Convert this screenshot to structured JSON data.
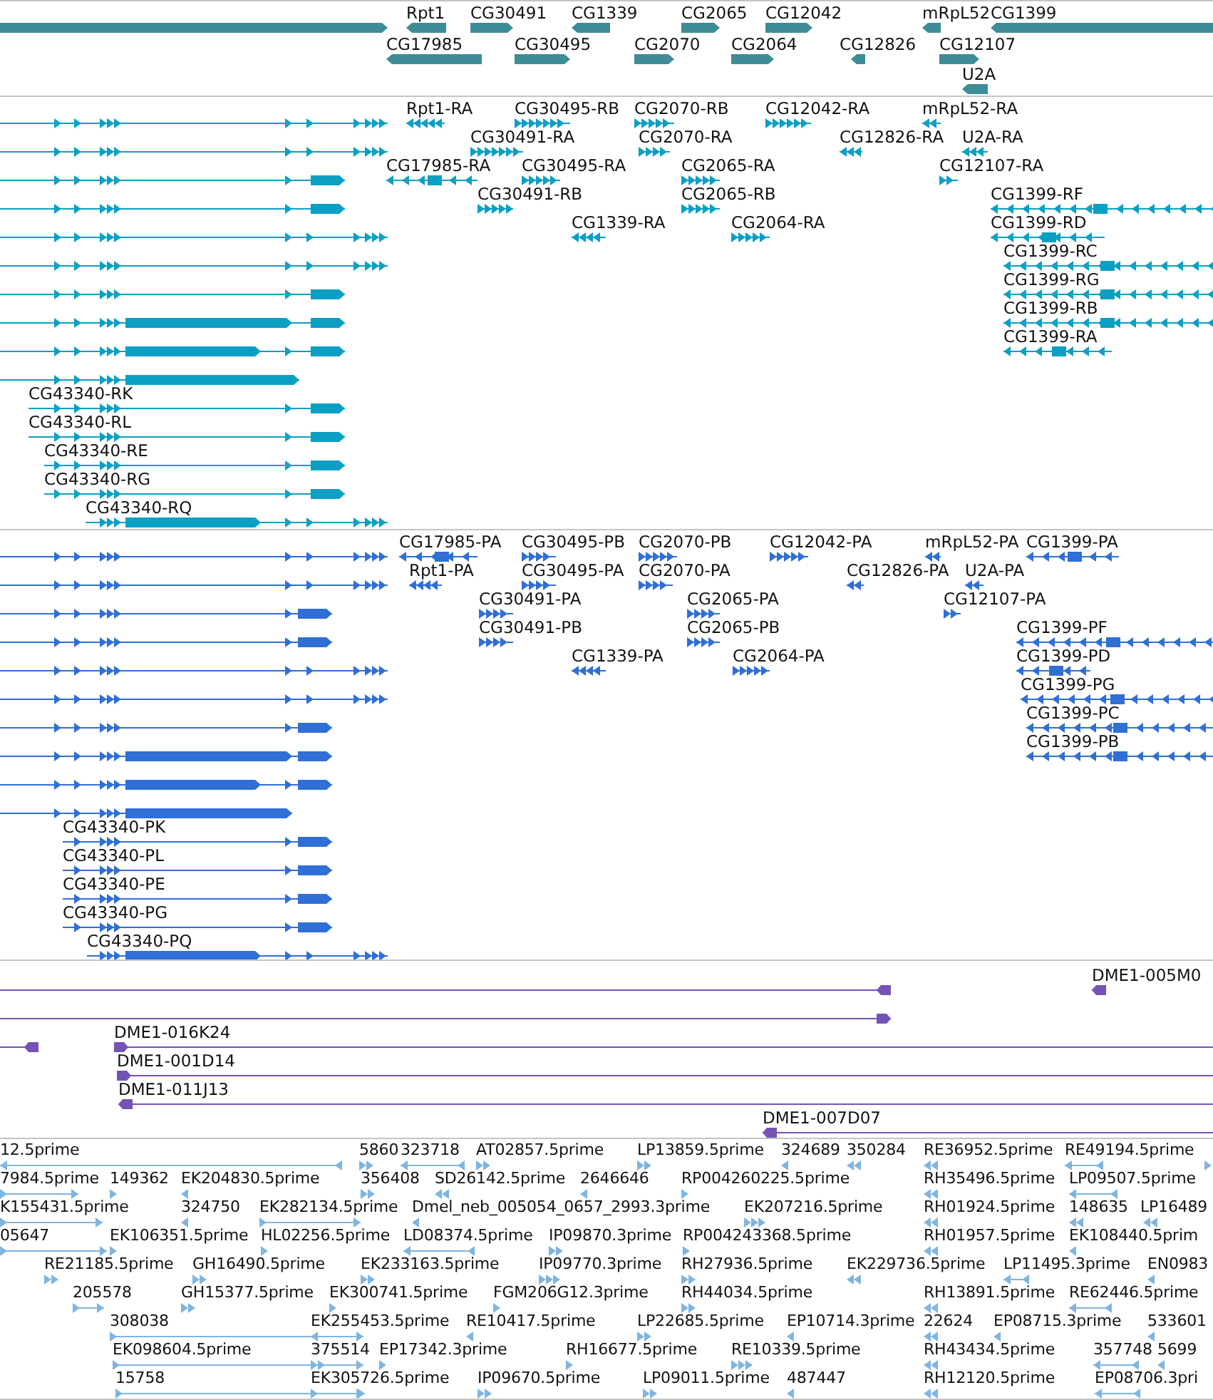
{
  "tracks": [
    {
      "kind": "gene",
      "features": [
        {
          "reverse": false
        },
        {
          "label": "Rpt1",
          "reverse": true
        },
        {
          "label": "CG30491",
          "reverse": false
        },
        {
          "label": "CG1339",
          "reverse": true
        },
        {
          "label": "CG2065",
          "reverse": false
        },
        {
          "label": "CG12042",
          "reverse": false
        },
        {
          "label": "mRpL52",
          "reverse": true
        },
        {
          "label": "CG1399",
          "reverse": true
        },
        {
          "label": "CG17985",
          "reverse": true
        },
        {
          "label": "CG30495",
          "reverse": false
        },
        {
          "label": "CG2070",
          "reverse": false
        },
        {
          "label": "CG2064",
          "reverse": false
        },
        {
          "label": "CG12826",
          "reverse": true
        },
        {
          "label": "CG12107",
          "reverse": false
        },
        {
          "label": "U2A",
          "reverse": true
        }
      ]
    },
    {
      "kind": "transcript",
      "features": [
        {
          "reverse": false
        },
        {
          "reverse": false
        },
        {
          "reverse": false
        },
        {
          "reverse": false
        },
        {
          "reverse": false
        },
        {
          "reverse": false
        },
        {
          "reverse": false
        },
        {
          "reverse": false
        },
        {
          "reverse": false
        },
        {
          "reverse": false
        },
        {
          "label": "CG43340-RK",
          "reverse": false
        },
        {
          "label": "CG43340-RL",
          "reverse": false
        },
        {
          "label": "CG43340-RE",
          "reverse": false
        },
        {
          "label": "CG43340-RG",
          "reverse": false
        },
        {
          "label": "CG43340-RQ",
          "reverse": false
        },
        {
          "label": "Rpt1-RA",
          "reverse": true
        },
        {
          "label": "CG30495-RB",
          "reverse": false
        },
        {
          "label": "CG2070-RB",
          "reverse": false
        },
        {
          "label": "CG12042-RA",
          "reverse": false
        },
        {
          "label": "mRpL52-RA",
          "reverse": true
        },
        {
          "label": "CG30491-RA",
          "reverse": false
        },
        {
          "label": "CG2070-RA",
          "reverse": false
        },
        {
          "label": "CG12826-RA",
          "reverse": true
        },
        {
          "label": "U2A-RA",
          "reverse": true
        },
        {
          "label": "CG17985-RA",
          "reverse": true
        },
        {
          "label": "CG30495-RA",
          "reverse": false
        },
        {
          "label": "CG2065-RA",
          "reverse": false
        },
        {
          "label": "CG12107-RA",
          "reverse": false
        },
        {
          "label": "CG30491-RB",
          "reverse": false
        },
        {
          "label": "CG2065-RB",
          "reverse": false
        },
        {
          "label": "CG1399-RF",
          "reverse": true
        },
        {
          "label": "CG1339-RA",
          "reverse": true
        },
        {
          "label": "CG2064-RA",
          "reverse": false
        },
        {
          "label": "CG1399-RD",
          "reverse": true
        },
        {
          "label": "CG1399-RC",
          "reverse": true
        },
        {
          "label": "CG1399-RG",
          "reverse": true
        },
        {
          "label": "CG1399-RB",
          "reverse": true
        },
        {
          "label": "CG1399-RA",
          "reverse": true
        }
      ]
    },
    {
      "kind": "protein",
      "features": [
        {
          "reverse": false
        },
        {
          "reverse": false
        },
        {
          "reverse": false
        },
        {
          "reverse": false
        },
        {
          "reverse": false
        },
        {
          "reverse": false
        },
        {
          "reverse": false
        },
        {
          "reverse": false
        },
        {
          "reverse": false
        },
        {
          "reverse": false
        },
        {
          "label": "CG43340-PK",
          "reverse": false
        },
        {
          "label": "CG43340-PL",
          "reverse": false
        },
        {
          "label": "CG43340-PE",
          "reverse": false
        },
        {
          "label": "CG43340-PG",
          "reverse": false
        },
        {
          "label": "CG43340-PQ",
          "reverse": false
        },
        {
          "label": "CG17985-PA",
          "reverse": true
        },
        {
          "label": "CG30495-PB",
          "reverse": false
        },
        {
          "label": "CG2070-PB",
          "reverse": false
        },
        {
          "label": "CG12042-PA",
          "reverse": false
        },
        {
          "label": "mRpL52-PA",
          "reverse": true
        },
        {
          "label": "CG1399-PA",
          "reverse": true
        },
        {
          "label": "Rpt1-PA",
          "reverse": true
        },
        {
          "label": "CG30495-PA",
          "reverse": false
        },
        {
          "label": "CG2070-PA",
          "reverse": false
        },
        {
          "label": "CG12826-PA",
          "reverse": true
        },
        {
          "label": "U2A-PA",
          "reverse": true
        },
        {
          "label": "CG30491-PA",
          "reverse": false
        },
        {
          "label": "CG2065-PA",
          "reverse": false
        },
        {
          "label": "CG12107-PA",
          "reverse": false
        },
        {
          "label": "CG30491-PB",
          "reverse": false
        },
        {
          "label": "CG2065-PB",
          "reverse": false
        },
        {
          "label": "CG1399-PF",
          "reverse": true
        },
        {
          "label": "CG1339-PA",
          "reverse": true
        },
        {
          "label": "CG2064-PA",
          "reverse": false
        },
        {
          "label": "CG1399-PD",
          "reverse": true
        },
        {
          "label": "CG1399-PG",
          "reverse": true
        },
        {
          "label": "CG1399-PC",
          "reverse": true
        },
        {
          "label": "CG1399-PB",
          "reverse": true
        }
      ]
    },
    {
      "kind": "clone",
      "features": [
        {
          "reverse": true
        },
        {
          "label": "DME1-005M0",
          "reverse": true
        },
        {
          "reverse": false
        },
        {
          "reverse": true
        },
        {
          "label": "DME1-016K24",
          "reverse": false
        },
        {
          "label": "DME1-001D14",
          "reverse": false
        },
        {
          "label": "DME1-011J13",
          "reverse": true
        },
        {
          "label": "DME1-007D07",
          "reverse": true
        }
      ]
    },
    {
      "kind": "est",
      "features": [
        {
          "label": "12.5prime",
          "reverse": true
        },
        {
          "label": "5860",
          "reverse": false
        },
        {
          "label": "323718",
          "reverse": true
        },
        {
          "label": "AT02857.5prime",
          "reverse": false
        },
        {
          "label": "LP13859.5prime",
          "reverse": false
        },
        {
          "label": "324689",
          "reverse": true
        },
        {
          "label": "350284",
          "reverse": true
        },
        {
          "label": "RE36952.5prime",
          "reverse": true
        },
        {
          "label": "RE49194.5prime",
          "reverse": true
        },
        {
          "reverse": false
        },
        {
          "label": "7984.5prime",
          "reverse": false
        },
        {
          "label": "149362",
          "reverse": false
        },
        {
          "label": "EK204830.5prime",
          "reverse": true
        },
        {
          "label": "356408",
          "reverse": false
        },
        {
          "label": "SD26142.5prime",
          "reverse": true
        },
        {
          "label": "2646646",
          "reverse": true
        },
        {
          "label": "RP004260225.5prime",
          "reverse": false
        },
        {
          "label": "RH35496.5prime",
          "reverse": true
        },
        {
          "label": "LP09507.5prime",
          "reverse": true
        },
        {
          "label": "K155431.5prime",
          "reverse": false
        },
        {
          "label": "324750",
          "reverse": true
        },
        {
          "label": "EK282134.5prime",
          "reverse": false
        },
        {
          "label": "Dmel_neb_005054_0657_2993.3prime",
          "reverse": true
        },
        {
          "label": "EK207216.5prime",
          "reverse": false
        },
        {
          "label": "RH01924.5prime",
          "reverse": true
        },
        {
          "label": "148635",
          "reverse": true
        },
        {
          "label": "LP16489",
          "reverse": true
        },
        {
          "label": "05647",
          "reverse": false
        },
        {
          "label": "EK106351.5prime",
          "reverse": false
        },
        {
          "label": "HL02256.5prime",
          "reverse": false
        },
        {
          "label": "LD08374.5prime",
          "reverse": true
        },
        {
          "label": "IP09870.3prime",
          "reverse": false
        },
        {
          "label": "RP004243368.5prime",
          "reverse": false
        },
        {
          "label": "RH01957.5prime",
          "reverse": true
        },
        {
          "label": "EK108440.5prim",
          "reverse": true
        },
        {
          "label": "RE21185.5prime",
          "reverse": false
        },
        {
          "label": "GH16490.5prime",
          "reverse": false
        },
        {
          "label": "EK233163.5prime",
          "reverse": false
        },
        {
          "label": "IP09770.3prime",
          "reverse": false
        },
        {
          "label": "RH27936.5prime",
          "reverse": false
        },
        {
          "label": "EK229736.5prime",
          "reverse": true
        },
        {
          "label": "LP11495.3prime",
          "reverse": true
        },
        {
          "label": "EN0983",
          "reverse": true
        },
        {
          "label": "205578",
          "reverse": false
        },
        {
          "label": "GH15377.5prime",
          "reverse": false
        },
        {
          "label": "EK300741.5prime",
          "reverse": false
        },
        {
          "label": "FGM206G12.3prime",
          "reverse": false
        },
        {
          "label": "RH44034.5prime",
          "reverse": false
        },
        {
          "label": "RH13891.5prime",
          "reverse": true
        },
        {
          "label": "RE62446.5prime",
          "reverse": true
        },
        {
          "label": "308038",
          "reverse": false
        },
        {
          "label": "EK255453.5prime",
          "reverse": true
        },
        {
          "label": "RE10417.5prime",
          "reverse": true
        },
        {
          "label": "LP22685.5prime",
          "reverse": false
        },
        {
          "label": "EP10714.3prime",
          "reverse": true
        },
        {
          "label": "22624",
          "reverse": true
        },
        {
          "label": "EP08715.3prime",
          "reverse": true
        },
        {
          "label": "533601",
          "reverse": true
        },
        {
          "label": "EK098604.5prime",
          "reverse": false
        },
        {
          "label": "375514",
          "reverse": false
        },
        {
          "label": "EP17342.3prime",
          "reverse": false
        },
        {
          "label": "RH16677.5prime",
          "reverse": false
        },
        {
          "label": "RE10339.5prime",
          "reverse": false
        },
        {
          "label": "RH43434.5prime",
          "reverse": true
        },
        {
          "label": "357748",
          "reverse": true
        },
        {
          "label": "5699",
          "reverse": true
        },
        {
          "label": "15758",
          "reverse": false
        },
        {
          "label": "EK305726.5prime",
          "reverse": false
        },
        {
          "label": "IP09670.5prime",
          "reverse": false
        },
        {
          "label": "LP09011.5prime",
          "reverse": false
        },
        {
          "label": "487447",
          "reverse": true
        },
        {
          "label": "RH12120.5prime",
          "reverse": true
        },
        {
          "label": "EP08706.3pri",
          "reverse": true
        }
      ]
    }
  ]
}
